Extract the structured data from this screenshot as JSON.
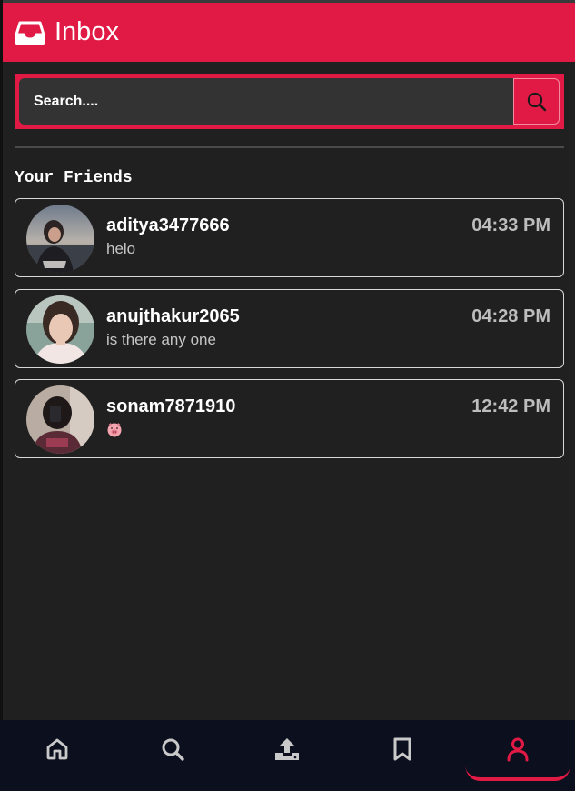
{
  "header": {
    "title": "Inbox",
    "icon": "inbox-tray-icon",
    "background": "#e11a45"
  },
  "search": {
    "placeholder": "Search....",
    "icon": "search-icon"
  },
  "section": {
    "title": "Your Friends"
  },
  "friends": [
    {
      "username": "aditya3477666",
      "last_message": "helo",
      "time": "04:33 PM"
    },
    {
      "username": "anujthakur2065",
      "last_message": "is there any one",
      "time": "04:28 PM"
    },
    {
      "username": "sonam7871910",
      "last_message": "🐷",
      "time": "12:42 PM"
    }
  ],
  "nav": {
    "items": [
      {
        "icon": "home-icon"
      },
      {
        "icon": "search-icon"
      },
      {
        "icon": "upload-icon"
      },
      {
        "icon": "bookmark-icon"
      },
      {
        "icon": "profile-icon",
        "active": true
      }
    ],
    "active_color": "#e11a45",
    "inactive_color": "#c9c9c9"
  }
}
